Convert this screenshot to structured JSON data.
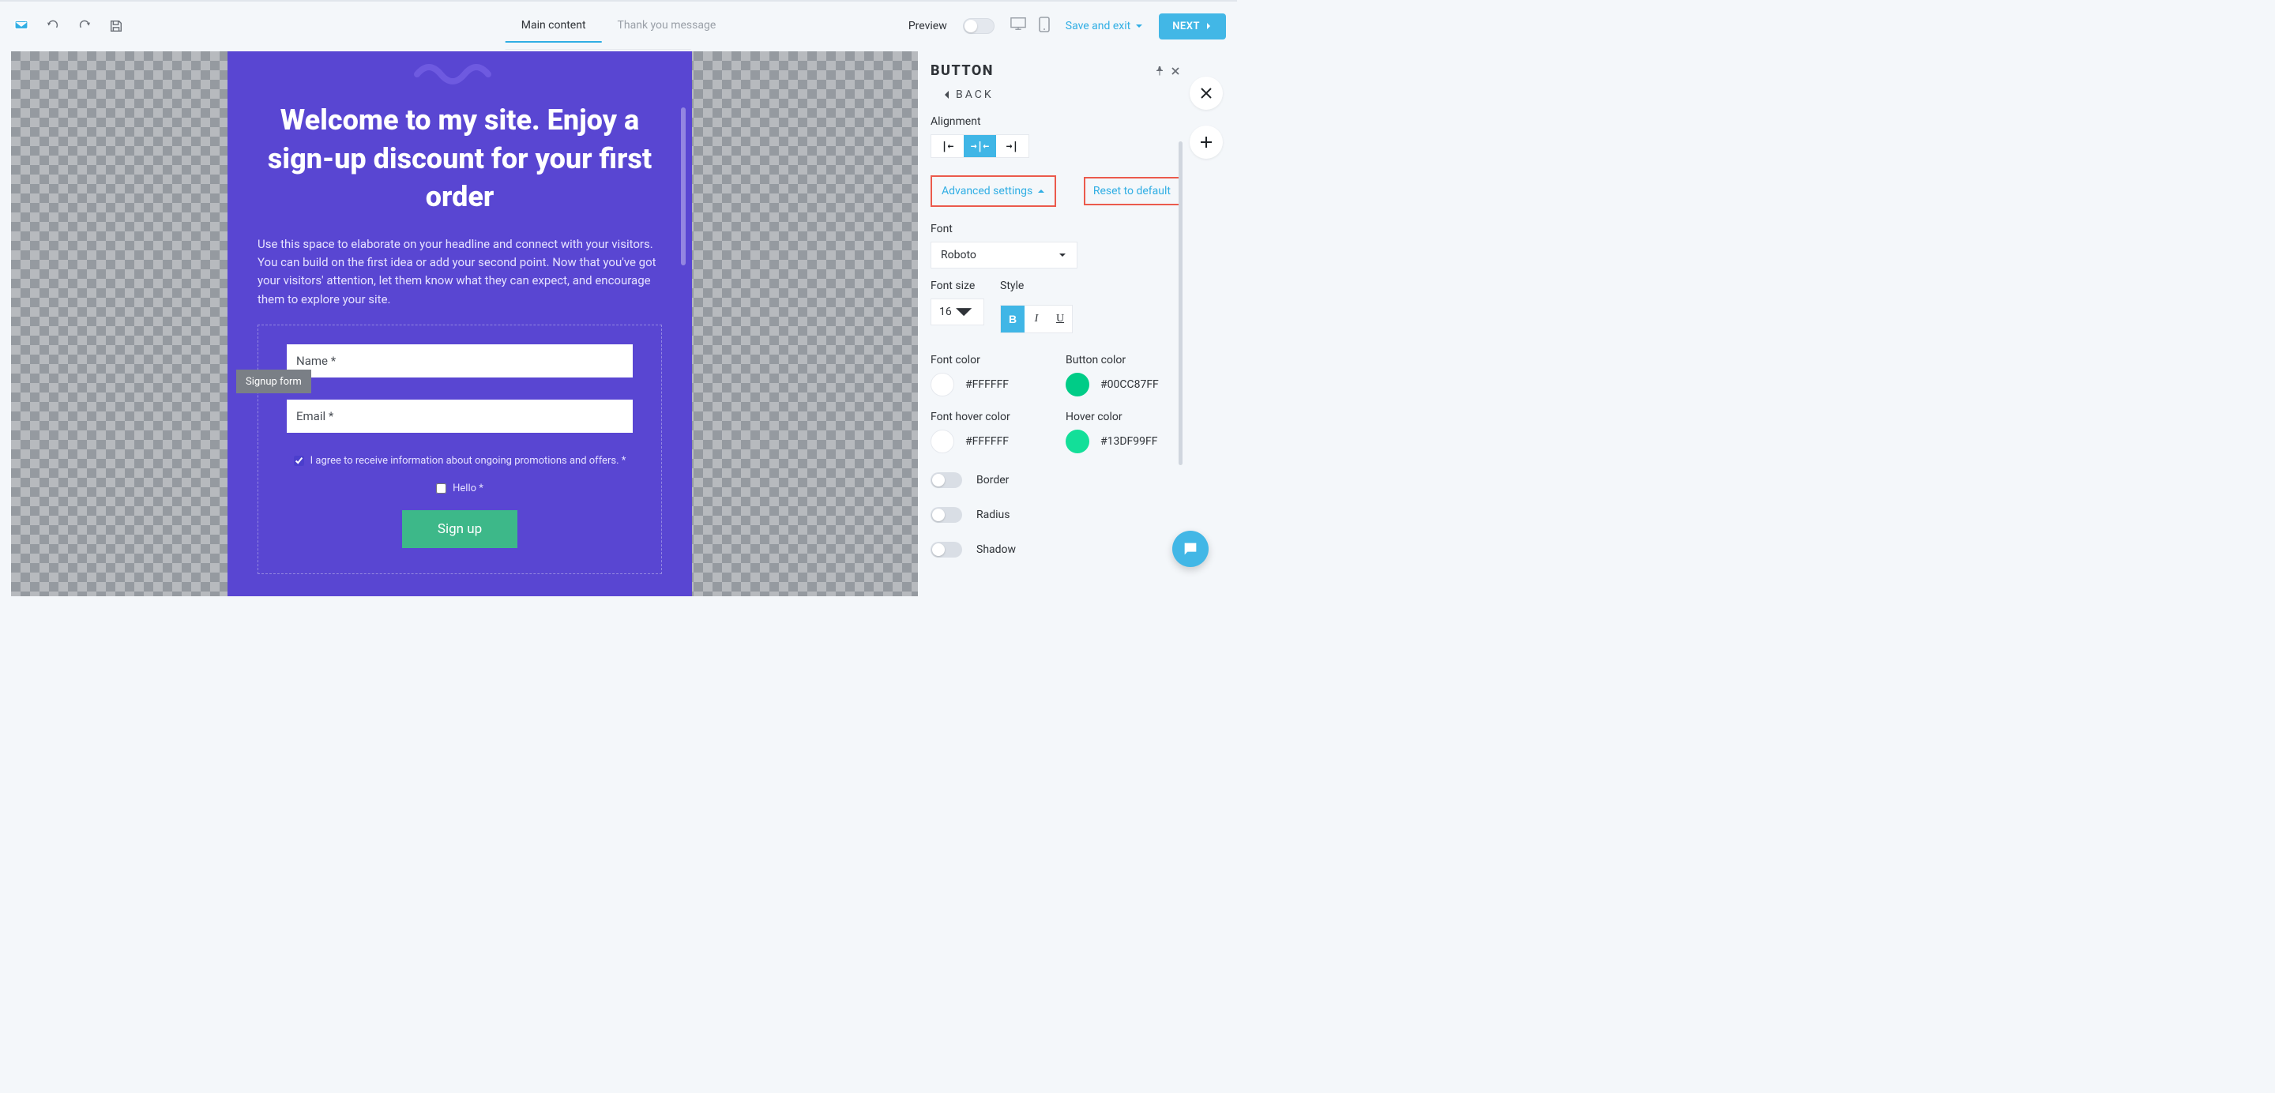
{
  "header": {
    "tabs": [
      {
        "label": "Main content",
        "active": true
      },
      {
        "label": "Thank you message",
        "active": false
      }
    ],
    "preview_label": "Preview",
    "save_exit_label": "Save and exit",
    "next_label": "NEXT"
  },
  "popup": {
    "headline": "Welcome to my site. Enjoy a sign-up discount for your first order",
    "body_text": "Use this space to elaborate on your headline and connect with your visitors. You can build on the first idea or add your second point. Now that you've got your visitors' attention, let them know what they can expect, and encourage them to explore your site.",
    "form_tag": "Signup form",
    "fields": {
      "name_placeholder": "Name *",
      "email_placeholder": "Email *"
    },
    "consent_text": "I agree to receive information about ongoing promotions and offers. *",
    "hello_text": "Hello *",
    "submit_label": "Sign up"
  },
  "panel": {
    "title": "BUTTON",
    "back_label": "BACK",
    "alignment_label": "Alignment",
    "alignment": {
      "options": [
        "left",
        "center",
        "right"
      ],
      "active": "center"
    },
    "advanced_label": "Advanced settings",
    "reset_label": "Reset to default",
    "font_label": "Font",
    "font_value": "Roboto",
    "font_size_label": "Font size",
    "font_size_value": "16",
    "style_label": "Style",
    "style_active": "B",
    "font_color_label": "Font color",
    "font_color_hex": "#FFFFFF",
    "button_color_label": "Button color",
    "button_color_hex": "#00CC87FF",
    "font_hover_label": "Font hover color",
    "font_hover_hex": "#FFFFFF",
    "hover_color_label": "Hover color",
    "hover_color_hex": "#13DF99FF",
    "border_label": "Border",
    "radius_label": "Radius",
    "shadow_label": "Shadow"
  }
}
